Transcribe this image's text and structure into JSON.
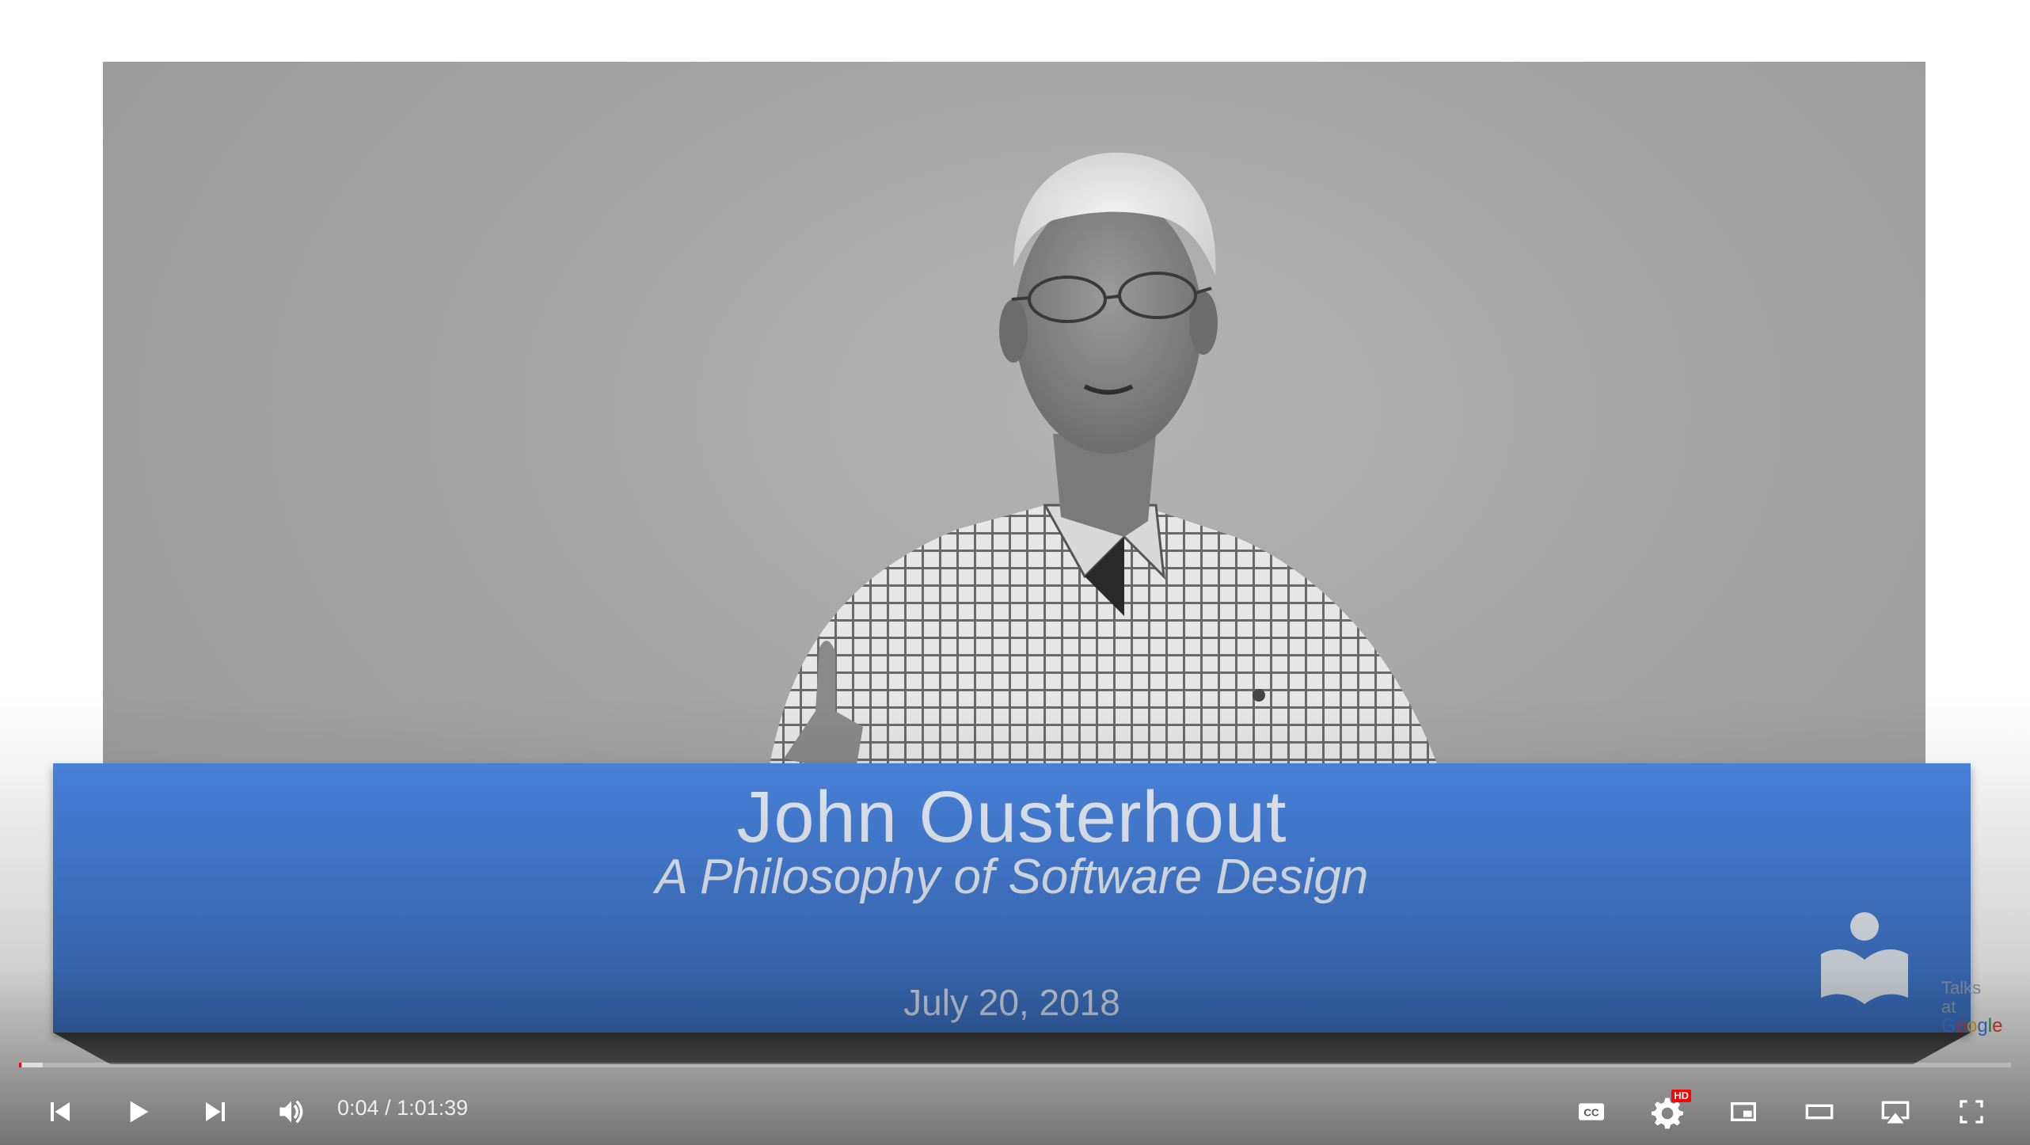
{
  "video": {
    "speaker_name": "John Ousterhout",
    "talk_title": "A Philosophy of Software Design",
    "date": "July 20, 2018",
    "channel_logo": {
      "icon": "talks-at-google-book-person-icon",
      "line1": "Talks",
      "line2": "at",
      "google_letters": [
        "G",
        "o",
        "o",
        "g",
        "l",
        "e"
      ]
    },
    "banner_color": "#4a84de"
  },
  "player": {
    "progress": {
      "played_fraction": 0.001,
      "loaded_fraction": 0.012,
      "played_color": "#ff0000"
    },
    "time": {
      "current": "0:04",
      "separator": " / ",
      "duration": "1:01:39"
    },
    "controls": {
      "previous": "previous-icon",
      "play": "play-icon",
      "next": "next-icon",
      "volume": "volume-icon",
      "captions": "captions-icon",
      "settings": "settings-icon",
      "settings_badge": "HD",
      "miniplayer": "miniplayer-icon",
      "theater": "theater-mode-icon",
      "airplay": "airplay-icon",
      "fullscreen": "fullscreen-icon"
    }
  }
}
